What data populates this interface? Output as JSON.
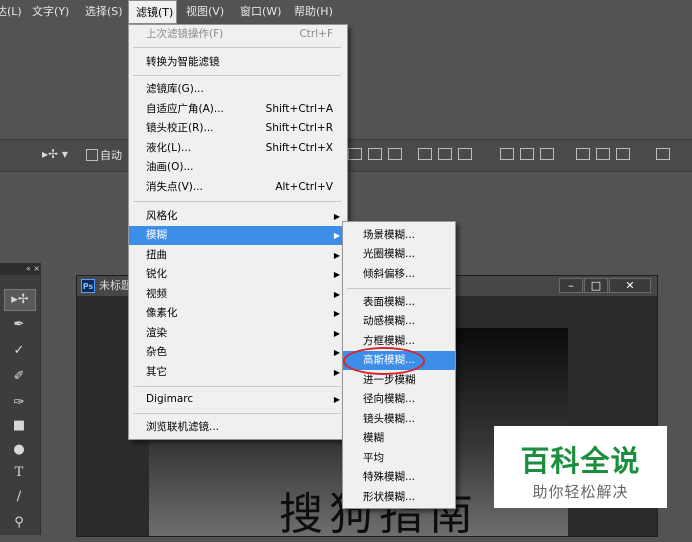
{
  "menubar": {
    "items": [
      "达(L)",
      "文字(Y)",
      "选择(S)",
      "滤镜(T)",
      "视图(V)",
      "窗口(W)",
      "帮助(H)"
    ],
    "active_index": 3
  },
  "options_bar": {
    "auto_select_label": "自动"
  },
  "filter_menu": {
    "items": [
      {
        "label": "上次滤镜操作(F)",
        "shortcut": "Ctrl+F",
        "disabled": true
      },
      {
        "label": "转换为智能滤镜"
      },
      {
        "label": "滤镜库(G)..."
      },
      {
        "label": "自适应广角(A)...",
        "shortcut": "Shift+Ctrl+A"
      },
      {
        "label": "镜头校正(R)...",
        "shortcut": "Shift+Ctrl+R"
      },
      {
        "label": "液化(L)...",
        "shortcut": "Shift+Ctrl+X"
      },
      {
        "label": "油画(O)..."
      },
      {
        "label": "消失点(V)...",
        "shortcut": "Alt+Ctrl+V"
      },
      {
        "label": "风格化",
        "submenu": true
      },
      {
        "label": "模糊",
        "submenu": true,
        "selected": true
      },
      {
        "label": "扭曲",
        "submenu": true
      },
      {
        "label": "锐化",
        "submenu": true
      },
      {
        "label": "视频",
        "submenu": true
      },
      {
        "label": "像素化",
        "submenu": true
      },
      {
        "label": "渲染",
        "submenu": true
      },
      {
        "label": "杂色",
        "submenu": true
      },
      {
        "label": "其它",
        "submenu": true
      },
      {
        "label": "Digimarc",
        "submenu": true
      },
      {
        "label": "浏览联机滤镜..."
      }
    ]
  },
  "blur_submenu": {
    "items": [
      {
        "label": "场景模糊..."
      },
      {
        "label": "光圈模糊..."
      },
      {
        "label": "倾斜偏移..."
      },
      {
        "label": "表面模糊..."
      },
      {
        "label": "动感模糊..."
      },
      {
        "label": "方框模糊..."
      },
      {
        "label": "高斯模糊...",
        "selected": true
      },
      {
        "label": "进一步模糊"
      },
      {
        "label": "径向模糊..."
      },
      {
        "label": "镜头模糊..."
      },
      {
        "label": "模糊"
      },
      {
        "label": "平均"
      },
      {
        "label": "特殊模糊..."
      },
      {
        "label": "形状模糊..."
      }
    ]
  },
  "document": {
    "title": "未标题",
    "ps_badge": "Ps",
    "canvas_text": "搜狗指南",
    "window_buttons": [
      "–",
      "□",
      "✕"
    ]
  },
  "tools_panel": {
    "collapse": "« ×"
  },
  "watermark": {
    "title": "百科全说",
    "subtitle": "助你轻松解决"
  },
  "colors": {
    "accent_selection": "#3d8ee8",
    "highlight_ring": "#d8242b",
    "watermark_green": "#1b8f3e"
  }
}
